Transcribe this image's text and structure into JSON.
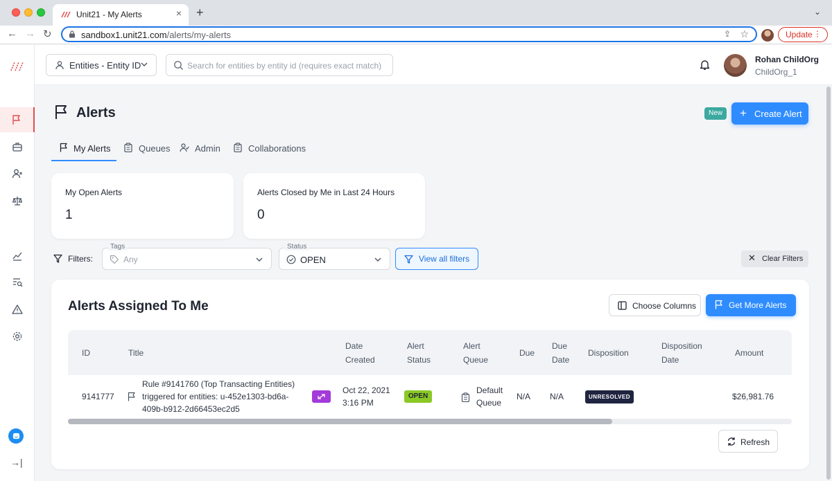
{
  "browser": {
    "tab_title": "Unit21 - My Alerts",
    "url_domain": "sandbox1.unit21.com",
    "url_path": "/alerts/my-alerts",
    "update_label": "Update"
  },
  "header": {
    "entity_select_label": "Entities - Entity ID",
    "search_placeholder": "Search for entities by entity id (requires exact match)",
    "user_name": "Rohan ChildOrg",
    "user_org": "ChildOrg_1"
  },
  "page": {
    "title": "Alerts",
    "new_badge": "New",
    "create_button": "Create Alert",
    "tabs": [
      {
        "label": "My Alerts",
        "active": true
      },
      {
        "label": "Queues"
      },
      {
        "label": "Admin"
      },
      {
        "label": "Collaborations"
      }
    ]
  },
  "stats": [
    {
      "label": "My Open Alerts",
      "value": "1"
    },
    {
      "label": "Alerts Closed by Me in Last 24 Hours",
      "value": "0"
    }
  ],
  "filters": {
    "label": "Filters:",
    "tags_legend": "Tags",
    "tags_placeholder": "Any",
    "status_legend": "Status",
    "status_value": "OPEN",
    "view_all": "View all filters",
    "clear": "Clear Filters"
  },
  "table": {
    "title": "Alerts Assigned To Me",
    "choose_columns": "Choose Columns",
    "get_more": "Get More Alerts",
    "columns": [
      "ID",
      "Title",
      "Date\nCreated",
      "Alert\nStatus",
      "Alert\nQueue",
      "Due",
      "Due\nDate",
      "Disposition",
      "Disposition\nDate",
      "Amount"
    ],
    "rows": [
      {
        "id": "9141777",
        "title": "Rule #9141760 (Top Transacting Entities) triggered for entities: u-452e1303-bd6a-409b-b912-2d66453ec2d5",
        "date_line1": "Oct 22, 2021",
        "date_line2": "3:16 PM",
        "status": "OPEN",
        "queue_line1": "Default",
        "queue_line2": "Queue",
        "due": "N/A",
        "due_date": "N/A",
        "disposition": "UNRESOLVED",
        "amount": "$26,981.76"
      }
    ],
    "refresh": "Refresh"
  },
  "colors": {
    "primary": "#2f8cff",
    "brand_red": "#e14d4d",
    "status_open": "#8ac926",
    "disposition_bg": "#1f2540",
    "new_badge": "#3ba9a0",
    "link_badge": "#a33ad9"
  },
  "icons": {
    "sidebar": [
      "flag-icon",
      "briefcase-icon",
      "user-x-icon",
      "scale-icon",
      "chart-line-icon",
      "search-list-icon",
      "warning-icon",
      "gear-icon"
    ]
  }
}
